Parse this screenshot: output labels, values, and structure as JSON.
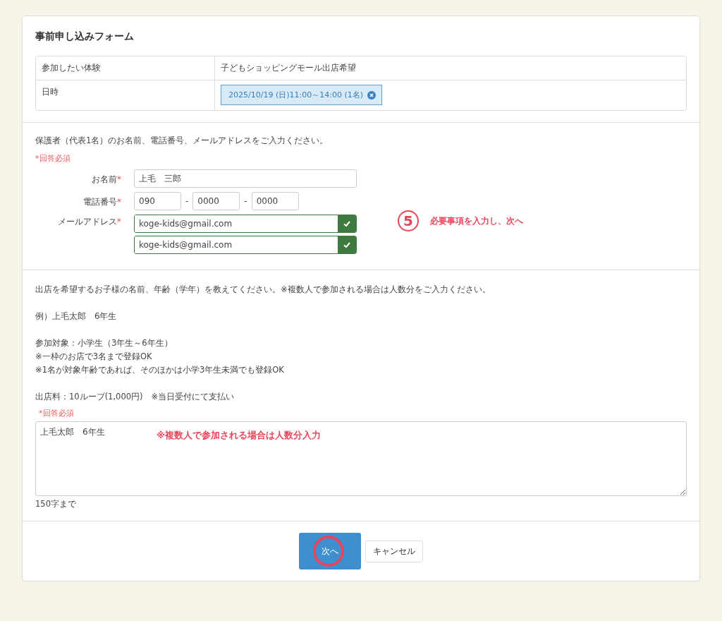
{
  "form_title": "事前申し込みフォーム",
  "summary": [
    {
      "label": "参加したい体験",
      "value": "子どもショッピングモール出店希望",
      "kind": "text"
    },
    {
      "label": "日時",
      "value": "2025/10/19 (日)11:00～14:00  (1名)",
      "kind": "tag"
    }
  ],
  "guardian": {
    "instruction": "保護者（代表1名）のお名前、電話番号、メールアドレスをご入力ください。",
    "required_note": "*回答必須",
    "name": {
      "label": "お名前",
      "required_mark": "*",
      "value": "上毛　三郎"
    },
    "phone": {
      "label": "電話番号",
      "required_mark": "*",
      "parts": [
        "090",
        "0000",
        "0000"
      ],
      "separator": "-"
    },
    "email": {
      "label": "メールアドレス",
      "required_mark": "*",
      "fields": [
        {
          "value": "koge-kids@gmail.com",
          "valid": true
        },
        {
          "value": "koge-kids@gmail.com",
          "valid": true
        }
      ]
    }
  },
  "step_annotation": {
    "number": "5",
    "text": "必要事項を入力し、次へ"
  },
  "children": {
    "paragraphs": [
      [
        "出店を希望するお子様の名前、年齢（学年）を教えてください。※複数人で参加される場合は人数分をご入力ください。"
      ],
      [
        "例）上毛太郎　6年生"
      ],
      [
        "参加対象：小学生（3年生～6年生）",
        "※一枠のお店で3名まで登録OK",
        "※1名が対象年齢であれば、そのほかは小学3年生未満でも登録OK"
      ],
      [
        "出店料：10ループ(1,000円)　※当日受付にて支払い"
      ]
    ],
    "required_note": "*回答必須",
    "value": "上毛太郎　6年生",
    "annotation": "※複数人で参加される場合は人数分入力",
    "limit_note": "150字まで"
  },
  "buttons": [
    {
      "label": "次へ",
      "kind": "primary",
      "highlighted": true
    },
    {
      "label": "キャンセル",
      "kind": "secondary",
      "highlighted": false
    }
  ]
}
